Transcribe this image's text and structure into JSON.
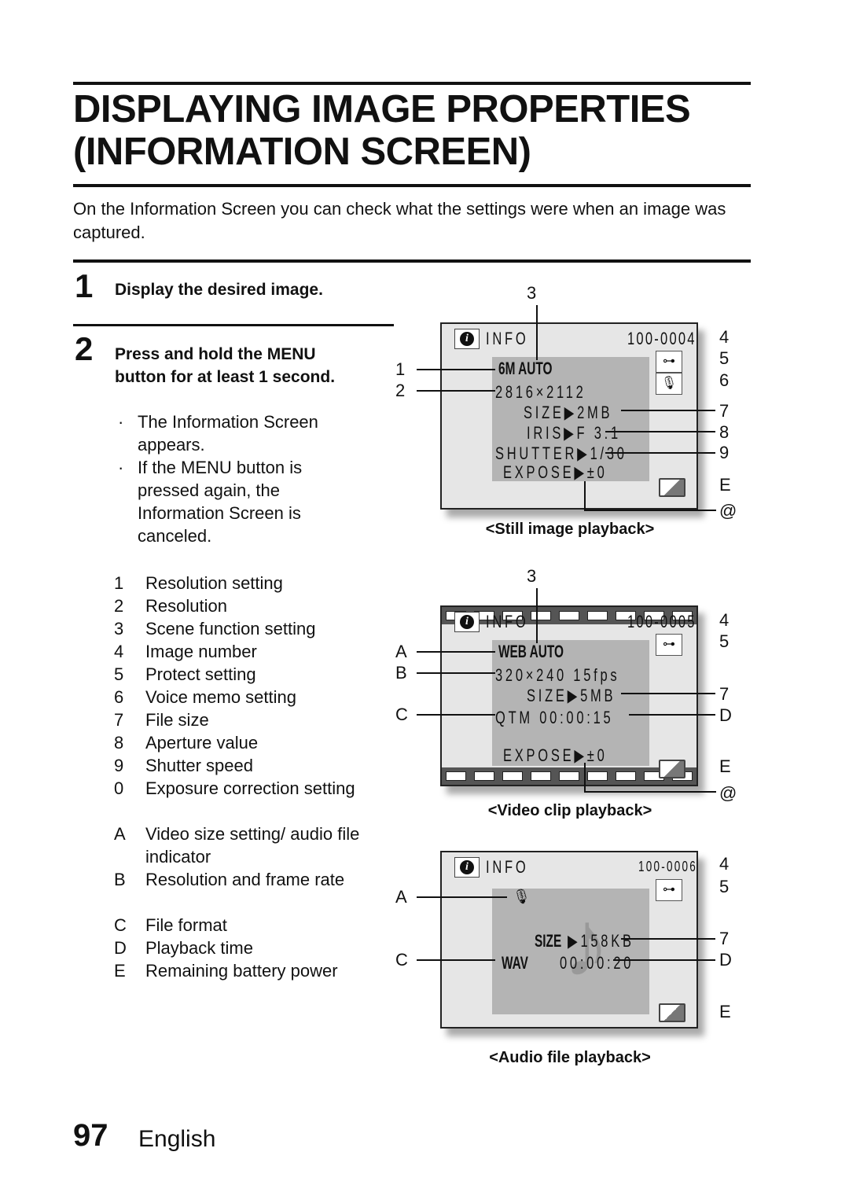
{
  "title_line1": "DISPLAYING IMAGE PROPERTIES",
  "title_line2": "(INFORMATION SCREEN)",
  "intro": "On the Information Screen you can check what the settings were when an image was captured.",
  "steps": [
    {
      "num": "1",
      "text": "Display the desired image."
    },
    {
      "num": "2",
      "text": "Press and hold the MENU button for at least 1 second.",
      "bullets": [
        "The Information Screen appears.",
        "If the MENU button is pressed again, the Information Screen is canceled."
      ]
    }
  ],
  "legend": [
    {
      "key": "1",
      "label": "Resolution setting"
    },
    {
      "key": "2",
      "label": "Resolution"
    },
    {
      "key": "3",
      "label": "Scene function setting"
    },
    {
      "key": "4",
      "label": "Image number"
    },
    {
      "key": "5",
      "label": "Protect setting"
    },
    {
      "key": "6",
      "label": "Voice memo setting"
    },
    {
      "key": "7",
      "label": "File size"
    },
    {
      "key": "8",
      "label": "Aperture value"
    },
    {
      "key": "9",
      "label": "Shutter speed"
    },
    {
      "key": "0",
      "label": "Exposure correction setting"
    },
    {
      "key": "A",
      "label": "Video size setting/ audio file indicator"
    },
    {
      "key": "B",
      "label": "Resolution and frame rate"
    },
    {
      "key": "C",
      "label": "File format"
    },
    {
      "key": "D",
      "label": "Playback time"
    },
    {
      "key": "E",
      "label": "Remaining battery power"
    }
  ],
  "screens": {
    "still": {
      "caption": "<Still image playback>",
      "info": "INFO",
      "number": "100-0004",
      "res_setting": "6M",
      "scene": "AUTO",
      "resolution": "2816×2112",
      "size": "SIZE▶2MB",
      "iris": "IRIS▶F 3.1",
      "shutter": "SHUTTER▶1/30",
      "expose": "EXPOSE▶±0"
    },
    "video": {
      "caption": "<Video clip playback>",
      "info": "INFO",
      "number": "100-0005",
      "video_size": "WEB",
      "scene": "AUTO",
      "resolution": "320×240  15fps",
      "size": "SIZE▶5MB",
      "format_time": "QTM 00:00:15",
      "expose": "EXPOSE▶±0"
    },
    "audio": {
      "caption": "<Audio file playback>",
      "info": "INFO",
      "number": "100-0006",
      "size_label": "SIZE",
      "size": "▶158KB",
      "format": "WAV",
      "time": "00:00:20"
    }
  },
  "callouts": {
    "c1": "1",
    "c2": "2",
    "c3": "3",
    "c4": "4",
    "c5": "5",
    "c6": "6",
    "c7": "7",
    "c8": "8",
    "c9": "9",
    "cE": "E",
    "cAt": "@",
    "cA": "A",
    "cB": "B",
    "cC": "C",
    "cD": "D"
  },
  "footer": {
    "page": "97",
    "language": "English"
  }
}
